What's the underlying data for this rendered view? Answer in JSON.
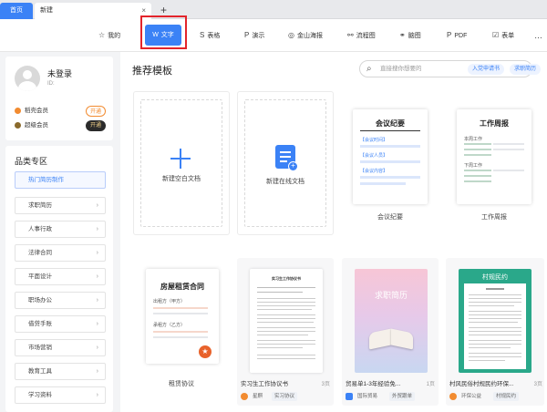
{
  "tabs": {
    "home": "首页",
    "doc": "新建",
    "close": "×",
    "add": "+"
  },
  "toolbar": {
    "items": [
      "我的",
      "文字",
      "表格",
      "演示",
      "金山海报",
      "流程图",
      "脑图",
      "PDF",
      "表单",
      "…"
    ],
    "icons": [
      "star-icon",
      "w-doc-icon",
      "table-icon",
      "presentation-icon",
      "poster-icon",
      "flowchart-icon",
      "mindmap-icon",
      "pdf-icon",
      "form-icon",
      "more-icon"
    ],
    "active_index": 1
  },
  "profile": {
    "name": "未登录",
    "id": "ID:"
  },
  "vip": [
    {
      "label": "稻壳会员",
      "action": "开通",
      "icon_color": "#f28b30"
    },
    {
      "label": "超级会员",
      "action": "开通",
      "icon_color": "#8a6a2c"
    }
  ],
  "categories": {
    "title": "品类专区",
    "items": [
      "热门简历制作",
      "求职简历",
      "人事行政",
      "法律合同",
      "平面设计",
      "职场办公",
      "借贷手账",
      "市场营销",
      "教育工具",
      "学习资料"
    ]
  },
  "main": {
    "title": "推荐模板"
  },
  "search": {
    "placeholder": "直接搜你想要的",
    "tags": [
      "入党申请书",
      "求职简历"
    ]
  },
  "templates_top": [
    {
      "label": "新建空白文档"
    },
    {
      "label": "新建在线文档"
    },
    {
      "label": "会议纪要",
      "thumb_title": "会议纪要",
      "fields": [
        "【会议时间】",
        "【会议人员】",
        "【会议内容】"
      ]
    },
    {
      "label": "工作周报",
      "thumb_title": "工作周报",
      "sections": [
        "本周工作",
        "下周工作"
      ]
    }
  ],
  "templates_bottom": [
    {
      "label": "租赁协议",
      "thumb_title": "房屋租赁合同",
      "lines": [
        "出租方（甲方）",
        "承租方（乙方）"
      ]
    },
    {
      "title": "实习生工作协议书",
      "pages": "3页",
      "author": "星麒",
      "tag": "实习协议",
      "thumb_heading": "实习生工作协议书"
    },
    {
      "title": "贸易单1-3年经验免...",
      "pages": "1页",
      "author": "国际贸易",
      "tag": "外贸跟单",
      "thumb_heading": "求职简历"
    },
    {
      "title": "村风民俗村规民约环保...",
      "pages": "3页",
      "author": "环保公益",
      "tag": "村规民约",
      "thumb_heading": "村规民约"
    }
  ],
  "colors": {
    "accent": "#3b82f6",
    "highlight": "#e3242b",
    "open_btn": "#f28b30"
  }
}
